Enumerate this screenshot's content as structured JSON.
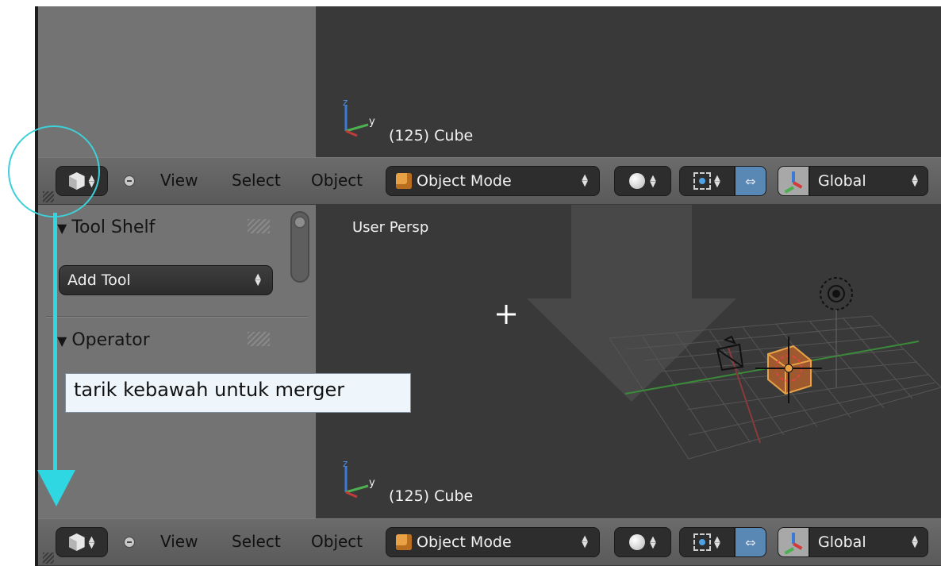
{
  "top_view": {
    "object_label": "(125) Cube",
    "axis_z": "z",
    "axis_y": "y"
  },
  "header": {
    "menu": [
      "View",
      "Select",
      "Object"
    ],
    "mode": "Object Mode",
    "orientation": "Global"
  },
  "tool_shelf": {
    "title": "Tool Shelf",
    "add_tool": "Add Tool",
    "operator": "Operator"
  },
  "viewport": {
    "view_label": "User Persp",
    "object_label": "(125) Cube",
    "axis_z": "z",
    "axis_y": "y"
  },
  "annotation": {
    "note": "tarik kebawah untuk merger",
    "color": "#2ed7e2"
  },
  "colors": {
    "header": "#6b6b6b",
    "panel": "#737373",
    "viewport": "#393939",
    "selected_object": "#e8a245"
  }
}
